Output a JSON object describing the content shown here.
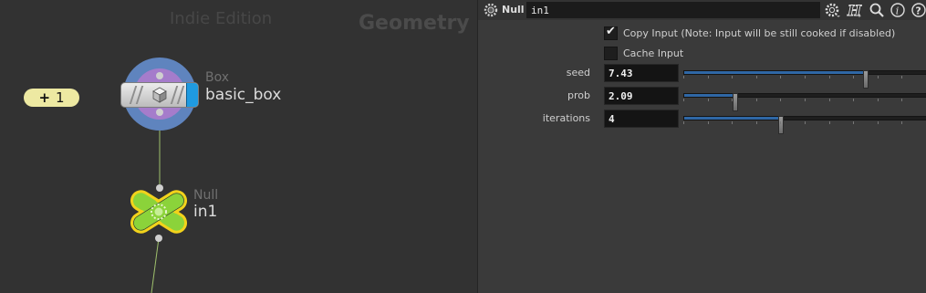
{
  "network": {
    "edition_watermark": "Indie Edition",
    "context_watermark": "Geometry",
    "sticky_label": "+",
    "sticky_count": "1",
    "nodes": [
      {
        "type": "Box",
        "name": "basic_box",
        "color": "#1f9ae0"
      },
      {
        "type": "Null",
        "name": "in1",
        "color": "#8bd33a"
      }
    ]
  },
  "params": {
    "node_type": "Null",
    "node_name": "in1",
    "header_icons": [
      "gear-icon",
      "help-h-icon",
      "search-icon",
      "info-icon",
      "help-icon"
    ],
    "checkboxes": [
      {
        "label": "Copy Input (Note: Input will be still cooked if disabled)",
        "checked": true
      },
      {
        "label": "Cache Input",
        "checked": false
      }
    ],
    "fields": [
      {
        "label": "seed",
        "value": "7.43",
        "fraction": 0.75
      },
      {
        "label": "prob",
        "value": "2.09",
        "fraction": 0.21
      },
      {
        "label": "iterations",
        "value": "4",
        "fraction": 0.4
      }
    ],
    "colors": {
      "accent": "#2f67a5",
      "selected_node": "#f2d21b"
    }
  }
}
